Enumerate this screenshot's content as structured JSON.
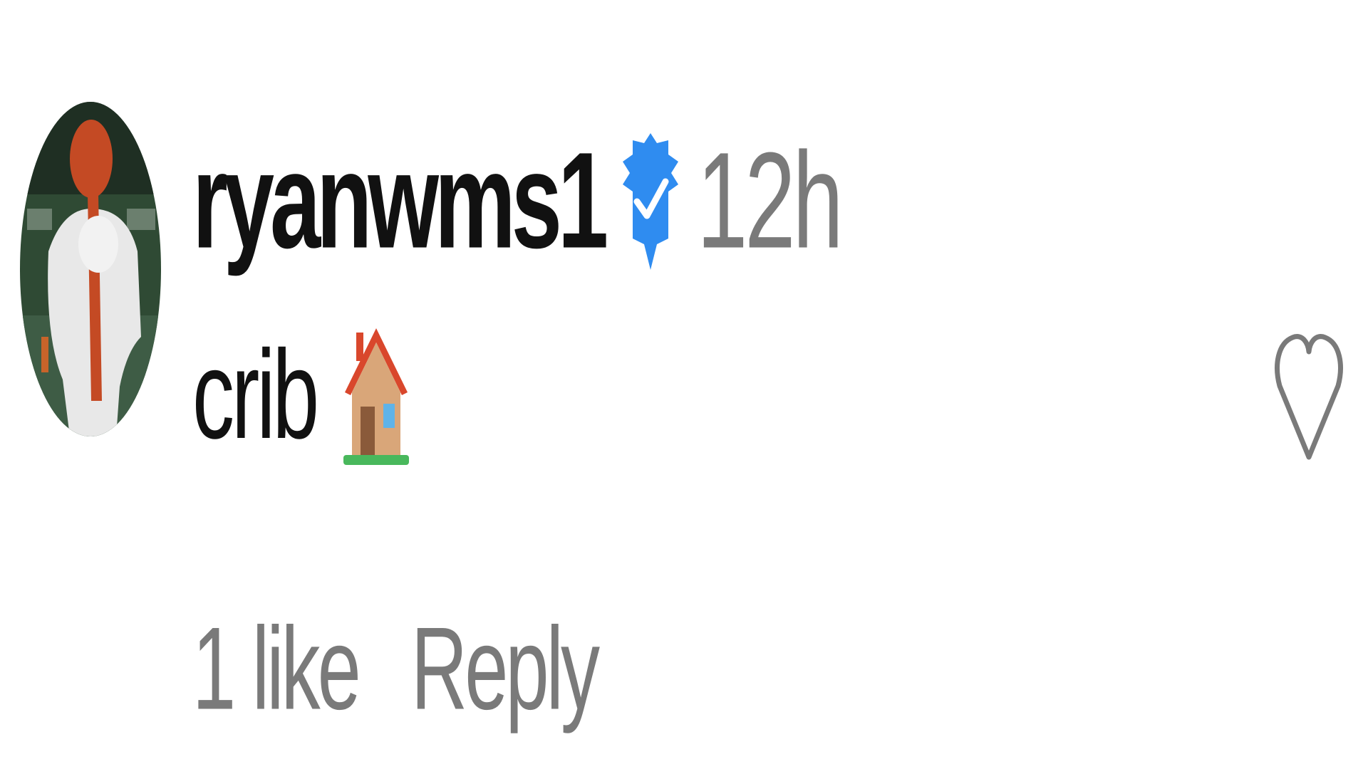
{
  "comment": {
    "avatar": "profile-photo",
    "username": "ryanwms1",
    "verified": true,
    "verified_icon": "verified-badge-icon",
    "timestamp": "12h",
    "text": "crib",
    "emoji": "house-icon",
    "like_icon": "heart-outline-icon",
    "likes_label": "1 like",
    "reply_label": "Reply"
  },
  "colors": {
    "username": "#111111",
    "meta": "#7a7a7a",
    "verified": "#2f8cf0",
    "background": "#ffffff"
  }
}
